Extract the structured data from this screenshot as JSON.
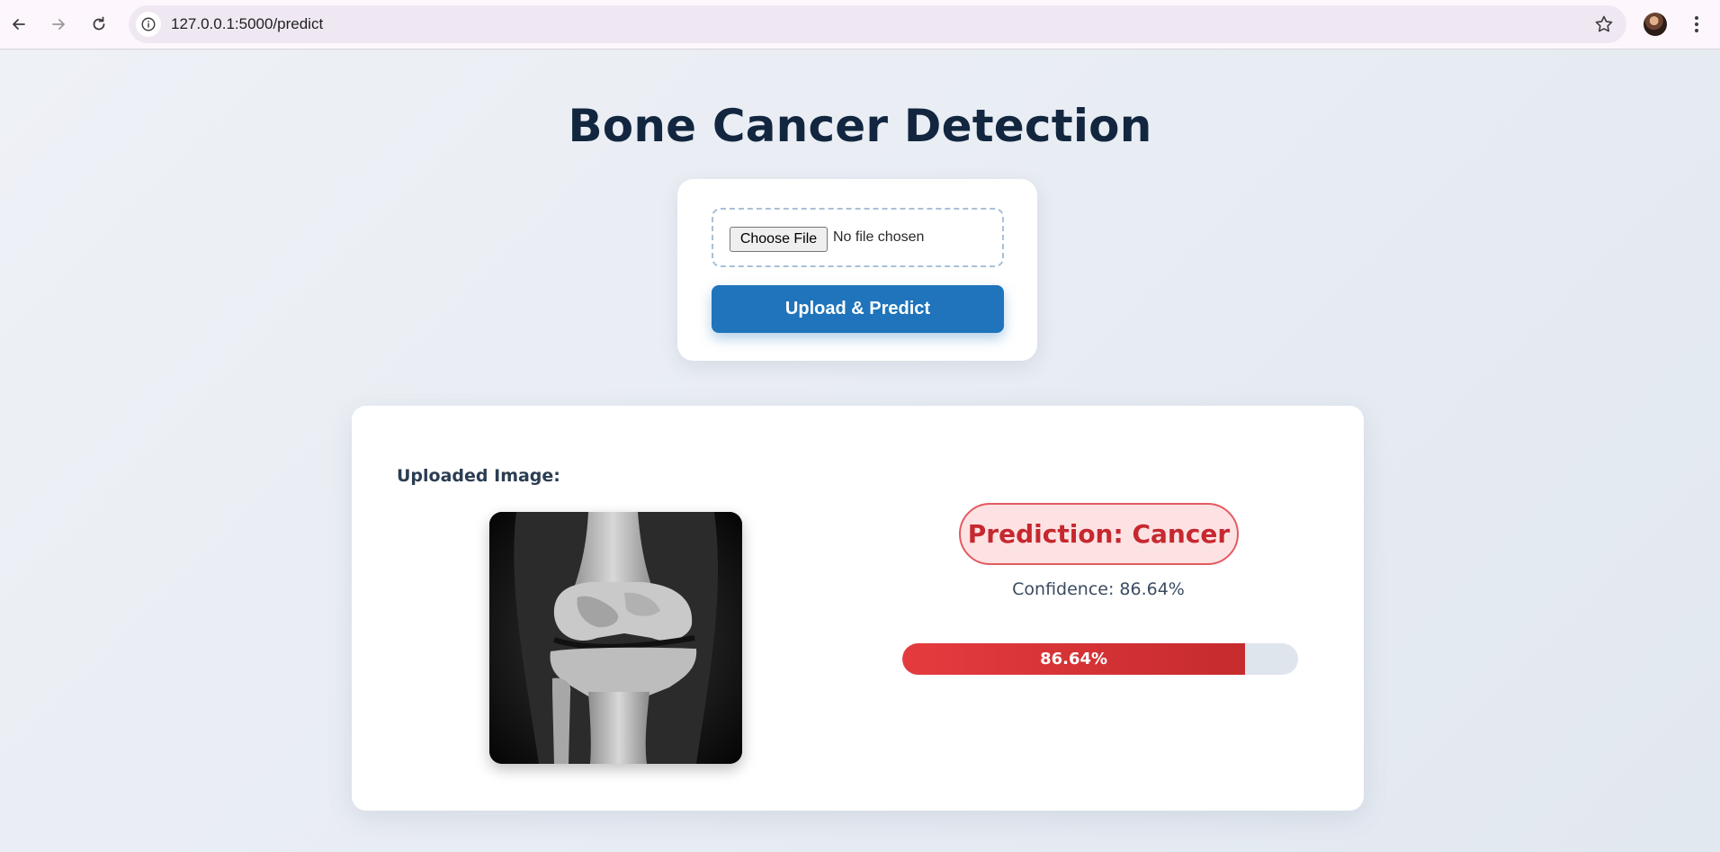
{
  "browser": {
    "url": "127.0.0.1:5000/predict"
  },
  "page": {
    "title": "Bone Cancer Detection"
  },
  "upload_form": {
    "choose_file_label": "Choose File",
    "file_status": "No file chosen",
    "submit_label": "Upload & Predict",
    "submit_color": "#1f74bb"
  },
  "result": {
    "uploaded_label": "Uploaded Image:",
    "prediction_text": "Prediction: Cancer",
    "prediction_color": "#c6282f",
    "confidence_text": "Confidence: 86.64%",
    "confidence_value": 86.64,
    "bar_label": "86.64%"
  },
  "icons": [
    "back-arrow-icon",
    "forward-arrow-icon",
    "reload-icon",
    "site-info-icon",
    "bookmark-star-icon",
    "profile-avatar",
    "menu-kebab-icon"
  ]
}
